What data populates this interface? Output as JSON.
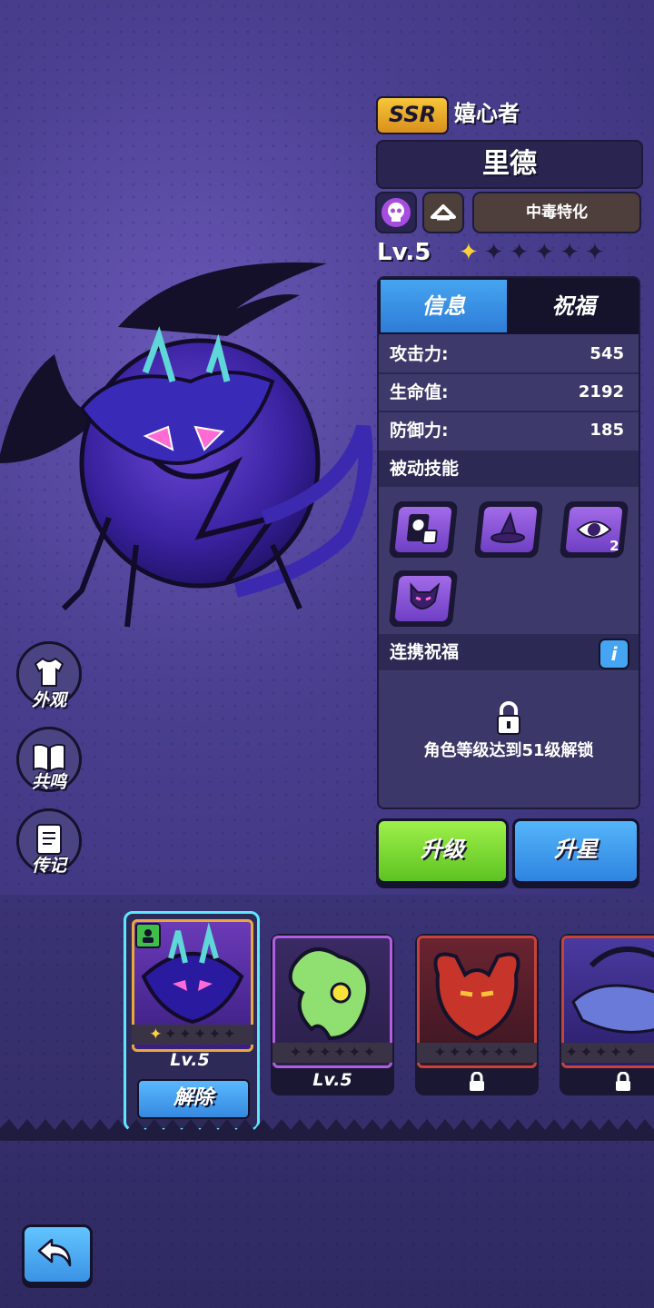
{
  "hero": {
    "rarity": "SSR",
    "title": "嬉心者",
    "name": "里德",
    "specialty": "中毒特化",
    "level": "Lv.5",
    "stars_filled": 1,
    "stars_total": 6
  },
  "tabs": {
    "info": "信息",
    "blessing": "祝福",
    "active": "info"
  },
  "stats": [
    {
      "label": "攻击力:",
      "value": "545"
    },
    {
      "label": "生命值:",
      "value": "2192"
    },
    {
      "label": "防御力:",
      "value": "185"
    }
  ],
  "passive": {
    "heading": "被动技能",
    "skills": [
      {
        "icon": "skull-cards-icon"
      },
      {
        "icon": "witch-hat-icon"
      },
      {
        "icon": "evil-eye-icon",
        "count": "2"
      },
      {
        "icon": "demon-mask-icon"
      }
    ]
  },
  "link_blessing": {
    "heading": "连携祝福",
    "info_label": "i",
    "lock_text": "角色等级达到51级解锁"
  },
  "actions": {
    "upgrade": "升级",
    "star_up": "升星"
  },
  "side_menu": [
    {
      "label": "外观",
      "icon": "shirt-icon"
    },
    {
      "label": "共鸣",
      "icon": "book-icon"
    },
    {
      "label": "传记",
      "icon": "journal-icon"
    }
  ],
  "roster": [
    {
      "level": "Lv.5",
      "stars_filled": 1,
      "action": "解除",
      "selected": true,
      "in_team": true,
      "locked": false,
      "frame_color": "#e8a93a"
    },
    {
      "level": "Lv.5",
      "stars_filled": 0,
      "selected": false,
      "locked": false,
      "frame_color": "#b15ee0"
    },
    {
      "stars_filled": 0,
      "locked": true,
      "frame_color": "#c4433b"
    },
    {
      "stars_filled": 0,
      "locked": true,
      "frame_color": "#c4433b"
    }
  ],
  "colors": {
    "accent_green": "#7ddc36",
    "accent_blue": "#3e9af0",
    "gold": "#f2b52e",
    "poison_purple": "#a64de0"
  }
}
